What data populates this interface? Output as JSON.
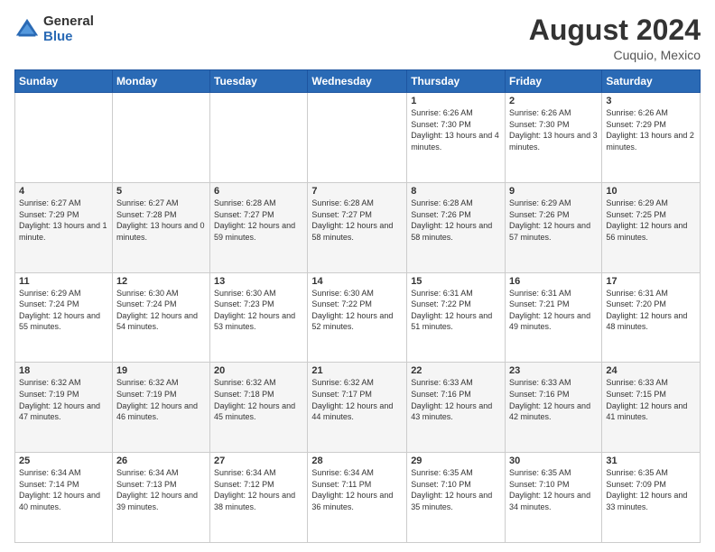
{
  "logo": {
    "general": "General",
    "blue": "Blue"
  },
  "header": {
    "month_year": "August 2024",
    "location": "Cuquio, Mexico"
  },
  "weekdays": [
    "Sunday",
    "Monday",
    "Tuesday",
    "Wednesday",
    "Thursday",
    "Friday",
    "Saturday"
  ],
  "weeks": [
    [
      {
        "day": "",
        "sunrise": "",
        "sunset": "",
        "daylight": ""
      },
      {
        "day": "",
        "sunrise": "",
        "sunset": "",
        "daylight": ""
      },
      {
        "day": "",
        "sunrise": "",
        "sunset": "",
        "daylight": ""
      },
      {
        "day": "",
        "sunrise": "",
        "sunset": "",
        "daylight": ""
      },
      {
        "day": "1",
        "sunrise": "Sunrise: 6:26 AM",
        "sunset": "Sunset: 7:30 PM",
        "daylight": "Daylight: 13 hours and 4 minutes."
      },
      {
        "day": "2",
        "sunrise": "Sunrise: 6:26 AM",
        "sunset": "Sunset: 7:30 PM",
        "daylight": "Daylight: 13 hours and 3 minutes."
      },
      {
        "day": "3",
        "sunrise": "Sunrise: 6:26 AM",
        "sunset": "Sunset: 7:29 PM",
        "daylight": "Daylight: 13 hours and 2 minutes."
      }
    ],
    [
      {
        "day": "4",
        "sunrise": "Sunrise: 6:27 AM",
        "sunset": "Sunset: 7:29 PM",
        "daylight": "Daylight: 13 hours and 1 minute."
      },
      {
        "day": "5",
        "sunrise": "Sunrise: 6:27 AM",
        "sunset": "Sunset: 7:28 PM",
        "daylight": "Daylight: 13 hours and 0 minutes."
      },
      {
        "day": "6",
        "sunrise": "Sunrise: 6:28 AM",
        "sunset": "Sunset: 7:27 PM",
        "daylight": "Daylight: 12 hours and 59 minutes."
      },
      {
        "day": "7",
        "sunrise": "Sunrise: 6:28 AM",
        "sunset": "Sunset: 7:27 PM",
        "daylight": "Daylight: 12 hours and 58 minutes."
      },
      {
        "day": "8",
        "sunrise": "Sunrise: 6:28 AM",
        "sunset": "Sunset: 7:26 PM",
        "daylight": "Daylight: 12 hours and 58 minutes."
      },
      {
        "day": "9",
        "sunrise": "Sunrise: 6:29 AM",
        "sunset": "Sunset: 7:26 PM",
        "daylight": "Daylight: 12 hours and 57 minutes."
      },
      {
        "day": "10",
        "sunrise": "Sunrise: 6:29 AM",
        "sunset": "Sunset: 7:25 PM",
        "daylight": "Daylight: 12 hours and 56 minutes."
      }
    ],
    [
      {
        "day": "11",
        "sunrise": "Sunrise: 6:29 AM",
        "sunset": "Sunset: 7:24 PM",
        "daylight": "Daylight: 12 hours and 55 minutes."
      },
      {
        "day": "12",
        "sunrise": "Sunrise: 6:30 AM",
        "sunset": "Sunset: 7:24 PM",
        "daylight": "Daylight: 12 hours and 54 minutes."
      },
      {
        "day": "13",
        "sunrise": "Sunrise: 6:30 AM",
        "sunset": "Sunset: 7:23 PM",
        "daylight": "Daylight: 12 hours and 53 minutes."
      },
      {
        "day": "14",
        "sunrise": "Sunrise: 6:30 AM",
        "sunset": "Sunset: 7:22 PM",
        "daylight": "Daylight: 12 hours and 52 minutes."
      },
      {
        "day": "15",
        "sunrise": "Sunrise: 6:31 AM",
        "sunset": "Sunset: 7:22 PM",
        "daylight": "Daylight: 12 hours and 51 minutes."
      },
      {
        "day": "16",
        "sunrise": "Sunrise: 6:31 AM",
        "sunset": "Sunset: 7:21 PM",
        "daylight": "Daylight: 12 hours and 49 minutes."
      },
      {
        "day": "17",
        "sunrise": "Sunrise: 6:31 AM",
        "sunset": "Sunset: 7:20 PM",
        "daylight": "Daylight: 12 hours and 48 minutes."
      }
    ],
    [
      {
        "day": "18",
        "sunrise": "Sunrise: 6:32 AM",
        "sunset": "Sunset: 7:19 PM",
        "daylight": "Daylight: 12 hours and 47 minutes."
      },
      {
        "day": "19",
        "sunrise": "Sunrise: 6:32 AM",
        "sunset": "Sunset: 7:19 PM",
        "daylight": "Daylight: 12 hours and 46 minutes."
      },
      {
        "day": "20",
        "sunrise": "Sunrise: 6:32 AM",
        "sunset": "Sunset: 7:18 PM",
        "daylight": "Daylight: 12 hours and 45 minutes."
      },
      {
        "day": "21",
        "sunrise": "Sunrise: 6:32 AM",
        "sunset": "Sunset: 7:17 PM",
        "daylight": "Daylight: 12 hours and 44 minutes."
      },
      {
        "day": "22",
        "sunrise": "Sunrise: 6:33 AM",
        "sunset": "Sunset: 7:16 PM",
        "daylight": "Daylight: 12 hours and 43 minutes."
      },
      {
        "day": "23",
        "sunrise": "Sunrise: 6:33 AM",
        "sunset": "Sunset: 7:16 PM",
        "daylight": "Daylight: 12 hours and 42 minutes."
      },
      {
        "day": "24",
        "sunrise": "Sunrise: 6:33 AM",
        "sunset": "Sunset: 7:15 PM",
        "daylight": "Daylight: 12 hours and 41 minutes."
      }
    ],
    [
      {
        "day": "25",
        "sunrise": "Sunrise: 6:34 AM",
        "sunset": "Sunset: 7:14 PM",
        "daylight": "Daylight: 12 hours and 40 minutes."
      },
      {
        "day": "26",
        "sunrise": "Sunrise: 6:34 AM",
        "sunset": "Sunset: 7:13 PM",
        "daylight": "Daylight: 12 hours and 39 minutes."
      },
      {
        "day": "27",
        "sunrise": "Sunrise: 6:34 AM",
        "sunset": "Sunset: 7:12 PM",
        "daylight": "Daylight: 12 hours and 38 minutes."
      },
      {
        "day": "28",
        "sunrise": "Sunrise: 6:34 AM",
        "sunset": "Sunset: 7:11 PM",
        "daylight": "Daylight: 12 hours and 36 minutes."
      },
      {
        "day": "29",
        "sunrise": "Sunrise: 6:35 AM",
        "sunset": "Sunset: 7:10 PM",
        "daylight": "Daylight: 12 hours and 35 minutes."
      },
      {
        "day": "30",
        "sunrise": "Sunrise: 6:35 AM",
        "sunset": "Sunset: 7:10 PM",
        "daylight": "Daylight: 12 hours and 34 minutes."
      },
      {
        "day": "31",
        "sunrise": "Sunrise: 6:35 AM",
        "sunset": "Sunset: 7:09 PM",
        "daylight": "Daylight: 12 hours and 33 minutes."
      }
    ]
  ]
}
